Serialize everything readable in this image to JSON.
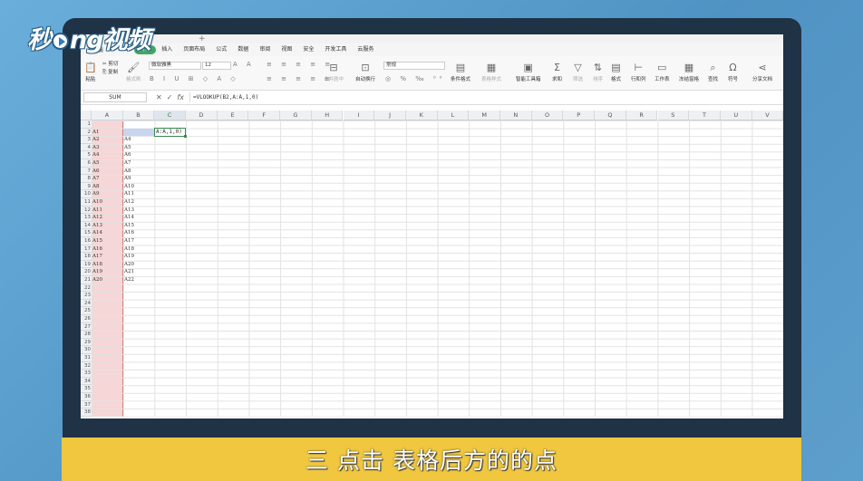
{
  "watermark": {
    "brand_pre": "秒",
    "brand_d": "d",
    "brand_ng": "ng",
    "brand_post": "视频"
  },
  "titlebar": {
    "add_tab": "+"
  },
  "menu": {
    "tabs": [
      "开始",
      "插入",
      "页面布局",
      "公式",
      "数据",
      "审阅",
      "视图",
      "安全",
      "开发工具",
      "云服务"
    ],
    "active": "开始"
  },
  "ribbon": {
    "paste": "粘贴",
    "cut": "剪切",
    "copy": "复制",
    "format_painter": "格式刷",
    "font_name": "微软雅黑",
    "font_size": "12",
    "merge": "合并居中",
    "wrap": "自动换行",
    "number_format": "常规",
    "conditional": "条件格式",
    "table_style": "表格样式",
    "smart_tools": "智能工具箱",
    "sum": "求和",
    "filter": "筛选",
    "sort": "排序",
    "format": "格式",
    "rowcol": "行和列",
    "sheet": "工作表",
    "freeze": "冻结窗格",
    "find": "查找",
    "symbol": "符号",
    "share": "分享文档"
  },
  "formula_bar": {
    "name_box": "SUM",
    "cancel": "✕",
    "confirm": "✓",
    "fx": "fx",
    "formula": "=VLOOKUP(B2,A:A,1,0)"
  },
  "columns": [
    "A",
    "B",
    "C",
    "D",
    "E",
    "F",
    "G",
    "H",
    "I",
    "J",
    "K",
    "L",
    "M",
    "N",
    "O",
    "P",
    "Q",
    "R",
    "S",
    "T",
    "U",
    "V"
  ],
  "selected_column": "C",
  "rows": [
    "1",
    "2",
    "3",
    "4",
    "5",
    "6",
    "7",
    "8",
    "9",
    "10",
    "11",
    "12",
    "13",
    "14",
    "15",
    "16",
    "17",
    "18",
    "19",
    "20",
    "21",
    "22",
    "23",
    "24",
    "25",
    "26",
    "27",
    "28",
    "29",
    "30",
    "31",
    "32",
    "33",
    "34",
    "35",
    "36",
    "37",
    "38"
  ],
  "col_a": [
    "",
    "A1",
    "A2",
    "A3",
    "A4",
    "A5",
    "A6",
    "A7",
    "A8",
    "A9",
    "A10",
    "A11",
    "A12",
    "A13",
    "A14",
    "A15",
    "A16",
    "A17",
    "A18",
    "A19",
    "A20"
  ],
  "col_b": [
    "",
    "",
    "A4",
    "A5",
    "A6",
    "A7",
    "A8",
    "A9",
    "A10",
    "A11",
    "A12",
    "A13",
    "A14",
    "A15",
    "A16",
    "A17",
    "A18",
    "A19",
    "A20",
    "A21",
    "A22"
  ],
  "active_cell_text": "A:A,1,0)",
  "caption": "三  点击 表格后方的的点"
}
